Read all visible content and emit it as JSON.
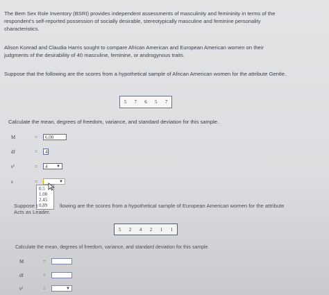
{
  "intro": {
    "p1": "The Bem Sex Role Inventory (BSRI) provides independent assessments of masculinity and femininity in terms of the respondent's self-reported possession of socially desirable, stereotypically masculine and feminine personality characteristics.",
    "p2": "Alison Konrad and Claudia Harris sought to compare African American and European American women on their judgments of the desirability of 40 masculine, feminine, or androgynous traits.",
    "p3": "Suppose that the following are the scores from a hypothetical sample of African American women for the attribute Gentle."
  },
  "sample1": {
    "scores": [
      "5",
      "7",
      "6",
      "5",
      "7"
    ]
  },
  "calc1": {
    "instruction": "Calculate the mean, degrees of freedom, variance, and standard deviation for this sample.",
    "rows": [
      {
        "label": "M",
        "eq": "=",
        "value": "6.00"
      },
      {
        "label": "df",
        "eq": "=",
        "value": "4"
      },
      {
        "label": "s²",
        "eq": "=",
        "value": "4"
      },
      {
        "label": "s",
        "eq": "=",
        "value": ""
      }
    ],
    "dropdown_options": [
      "0.5",
      "1.00",
      "2.45",
      "0.89"
    ]
  },
  "p4_prefix": "Suppose t",
  "p4_suffix": "llowing are the scores from a hypothetical sample of European American women for the attribute",
  "p4_line2": "Acts as Leader.",
  "sample2": {
    "scores": [
      "5",
      "2",
      "4",
      "2",
      "1",
      "1"
    ]
  },
  "calc2": {
    "instruction": "Calculate the mean, degrees of freedom, variance, and standard deviation for this sample.",
    "rows": [
      {
        "label": "M",
        "eq": "="
      },
      {
        "label": "df",
        "eq": "="
      },
      {
        "label": "s²",
        "eq": "="
      }
    ]
  },
  "icons": {
    "caret": "chevron-down-icon",
    "cursor": "mouse-cursor-icon"
  }
}
